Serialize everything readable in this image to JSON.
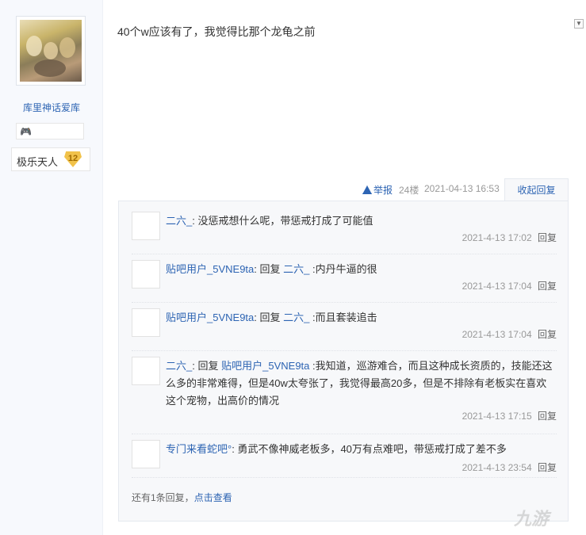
{
  "author": {
    "username": "库里神话爱库",
    "badge_icon": "game-controller-icon",
    "level_name": "极乐天人",
    "level_number": "12"
  },
  "post": {
    "content": "40个w应该有了，我觉得比那个龙龟之前",
    "report_label": "举报",
    "floor": "24楼",
    "time": "2021-04-13 16:53",
    "collapse_label": "收起回复"
  },
  "replies": [
    {
      "user": "二六_",
      "colon": ":",
      "text": "没惩戒想什么呢，带惩戒打成了可能值",
      "time": "2021-4-13 17:02",
      "reply_label": "回复"
    },
    {
      "user": "贴吧用户_5VNE9ta",
      "colon": ":",
      "reply_word": "回复",
      "target": "二六_",
      "text": ":内丹牛逼的很",
      "time": "2021-4-13 17:04",
      "reply_label": "回复"
    },
    {
      "user": "贴吧用户_5VNE9ta",
      "colon": ":",
      "reply_word": "回复",
      "target": "二六_",
      "text": ":而且套装追击",
      "time": "2021-4-13 17:04",
      "reply_label": "回复"
    },
    {
      "user": "二六_",
      "colon": ":",
      "reply_word": "回复",
      "target": "贴吧用户_5VNE9ta",
      "text": ":我知道，巡游难合，而且这种成长资质的，技能还这么多的非常难得，但是40w太夸张了，我觉得最高20多，但是不排除有老板实在喜欢这个宠物，出高价的情况",
      "time": "2021-4-13 17:15",
      "reply_label": "回复"
    },
    {
      "user": "专门来看蛇吧°",
      "colon": ":",
      "text": "勇武不像神威老板多，40万有点难吧，带惩戒打成了差不多",
      "time": "2021-4-13 23:54",
      "reply_label": "回复"
    }
  ],
  "more": {
    "text": "还有1条回复，",
    "link": "点击查看"
  },
  "watermark": "九游"
}
